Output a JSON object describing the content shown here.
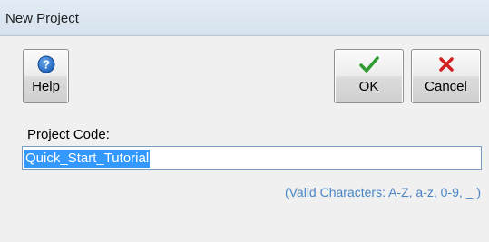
{
  "window": {
    "title": "New Project"
  },
  "toolbar": {
    "help_label": "Help",
    "ok_label": "OK",
    "cancel_label": "Cancel",
    "help_icon": "question-circle-icon",
    "ok_icon": "green-checkmark-icon",
    "cancel_icon": "red-x-icon"
  },
  "form": {
    "project_code_label": "Project Code:",
    "project_code_value": "Quick_Start_Tutorial",
    "hint": "(Valid Characters: A-Z, a-z, 0-9, _ )"
  },
  "colors": {
    "help_icon": "#1c5fb8",
    "ok_icon": "#2f9a2f",
    "cancel_icon": "#d22020",
    "selection": "#3399ff",
    "hint_text": "#4a86c5"
  }
}
